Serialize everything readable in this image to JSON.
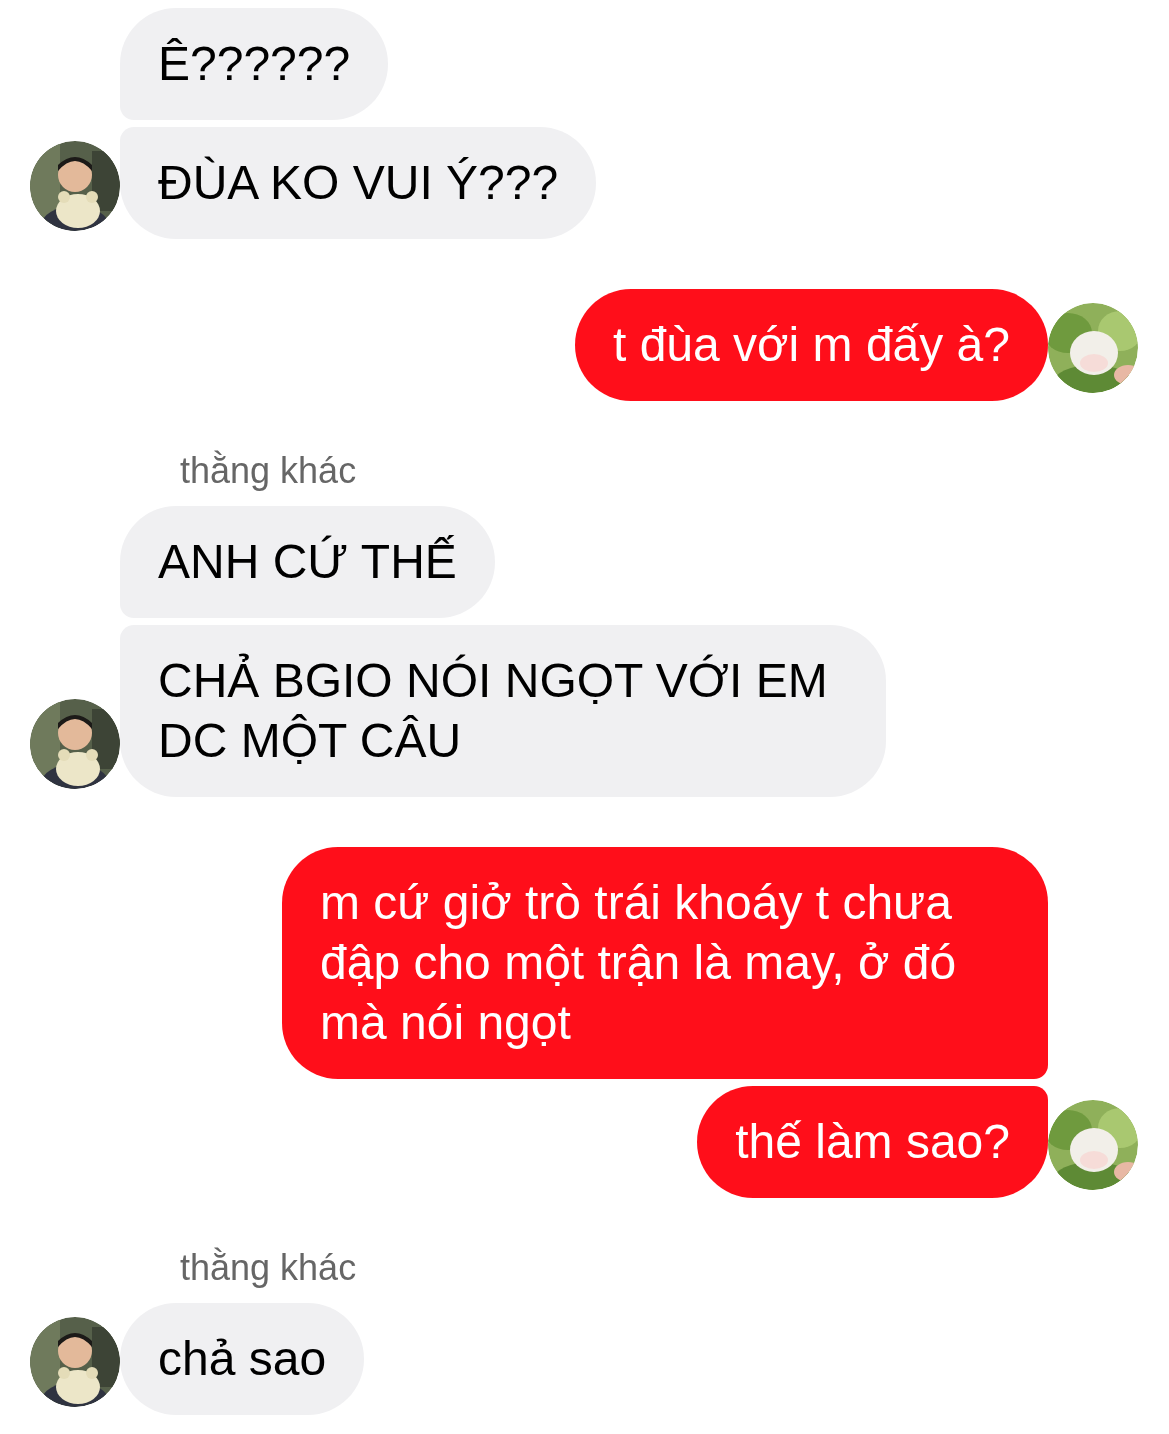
{
  "messages": [
    {
      "kind": "incoming",
      "bubbles": [
        "Ê??????",
        "ĐÙA KO VUI Ý???"
      ]
    },
    {
      "kind": "outgoing",
      "bubbles": [
        "t đùa với m đấy à?"
      ]
    },
    {
      "kind": "incoming",
      "sender": "thằng khác",
      "bubbles": [
        "ANH CỨ THẾ",
        "CHẢ BGIO NÓI NGỌT VỚI EM DC MỘT CÂU"
      ]
    },
    {
      "kind": "outgoing",
      "bubbles": [
        "m cứ giở trò trái khoáy t chưa đập cho một trận là may, ở đó mà nói ngọt",
        "thế làm sao?"
      ]
    },
    {
      "kind": "incoming",
      "sender": "thằng khác",
      "bubbles": [
        "chả sao"
      ]
    }
  ]
}
